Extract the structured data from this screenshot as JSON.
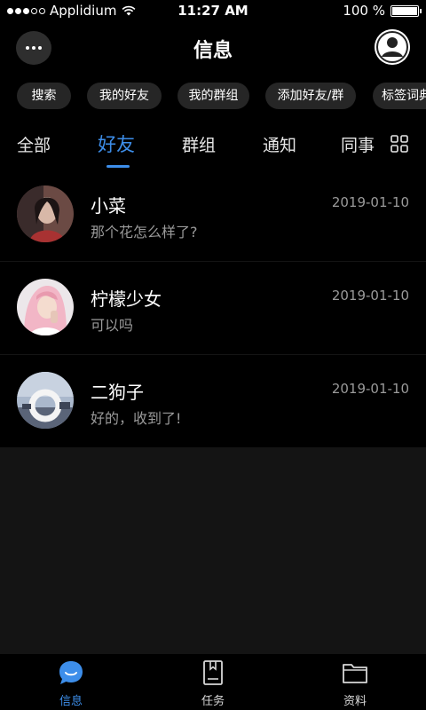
{
  "status_bar": {
    "carrier": "Applidium",
    "time": "11:27 AM",
    "battery": "100 %",
    "battery_level": 1.0
  },
  "header": {
    "title": "信息",
    "more_icon": "more-dots-icon",
    "profile_icon": "user-avatar-icon"
  },
  "chips": [
    {
      "label": "搜索"
    },
    {
      "label": "我的好友"
    },
    {
      "label": "我的群组"
    },
    {
      "label": "添加好友/群"
    },
    {
      "label": "标签词典"
    }
  ],
  "tabs": [
    {
      "label": "全部",
      "active": false
    },
    {
      "label": "好友",
      "active": true
    },
    {
      "label": "群组",
      "active": false
    },
    {
      "label": "通知",
      "active": false
    },
    {
      "label": "同事",
      "active": false
    }
  ],
  "chats": [
    {
      "name": "小菜",
      "preview": "那个花怎么样了?",
      "date": "2019-01-10"
    },
    {
      "name": "柠檬少女",
      "preview": "可以吗",
      "date": "2019-01-10"
    },
    {
      "name": "二狗子",
      "preview": "好的，收到了!",
      "date": "2019-01-10"
    }
  ],
  "bottom_nav": [
    {
      "label": "信息",
      "icon": "chat-bubble-icon",
      "active": true
    },
    {
      "label": "任务",
      "icon": "task-book-icon",
      "active": false
    },
    {
      "label": "资料",
      "icon": "folder-icon",
      "active": false
    }
  ],
  "colors": {
    "accent": "#3d8eea",
    "background": "#141414",
    "surface": "#000000",
    "chip": "#262626",
    "muted_text": "#9a9a9a"
  }
}
